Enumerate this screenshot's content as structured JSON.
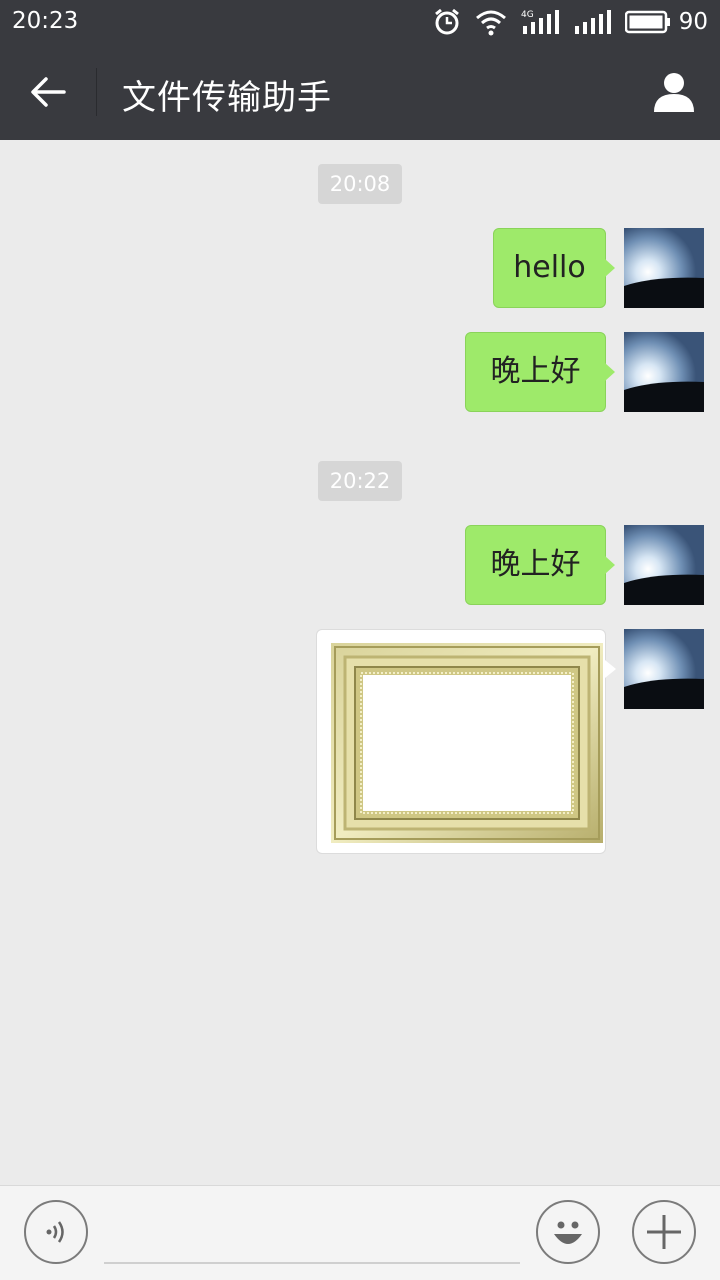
{
  "status_bar": {
    "time": "20:23",
    "network_label": "4G",
    "battery_percent": "90",
    "icons": [
      "alarm-icon",
      "wifi-icon",
      "signal-4g-icon",
      "signal-icon",
      "battery-icon"
    ]
  },
  "header": {
    "title": "文件传输助手",
    "back_icon": "arrow-left-icon",
    "profile_icon": "person-icon"
  },
  "messages": [
    {
      "type": "timestamp",
      "text": "20:08"
    },
    {
      "type": "text",
      "sender": "me",
      "text": "hello"
    },
    {
      "type": "text",
      "sender": "me",
      "text": "晚上好"
    },
    {
      "type": "timestamp",
      "text": "20:22"
    },
    {
      "type": "text",
      "sender": "me",
      "text": "晚上好"
    },
    {
      "type": "image",
      "sender": "me",
      "image": "gold-picture-frame"
    }
  ],
  "input_bar": {
    "value": "",
    "voice_icon": "voice-icon",
    "emoji_icon": "emoji-icon",
    "plus_icon": "plus-icon"
  },
  "colors": {
    "bar_bg": "#393a3f",
    "chat_bg": "#ebebeb",
    "bubble_green": "#9eea6a",
    "timestamp_bg": "#d6d6d6"
  }
}
